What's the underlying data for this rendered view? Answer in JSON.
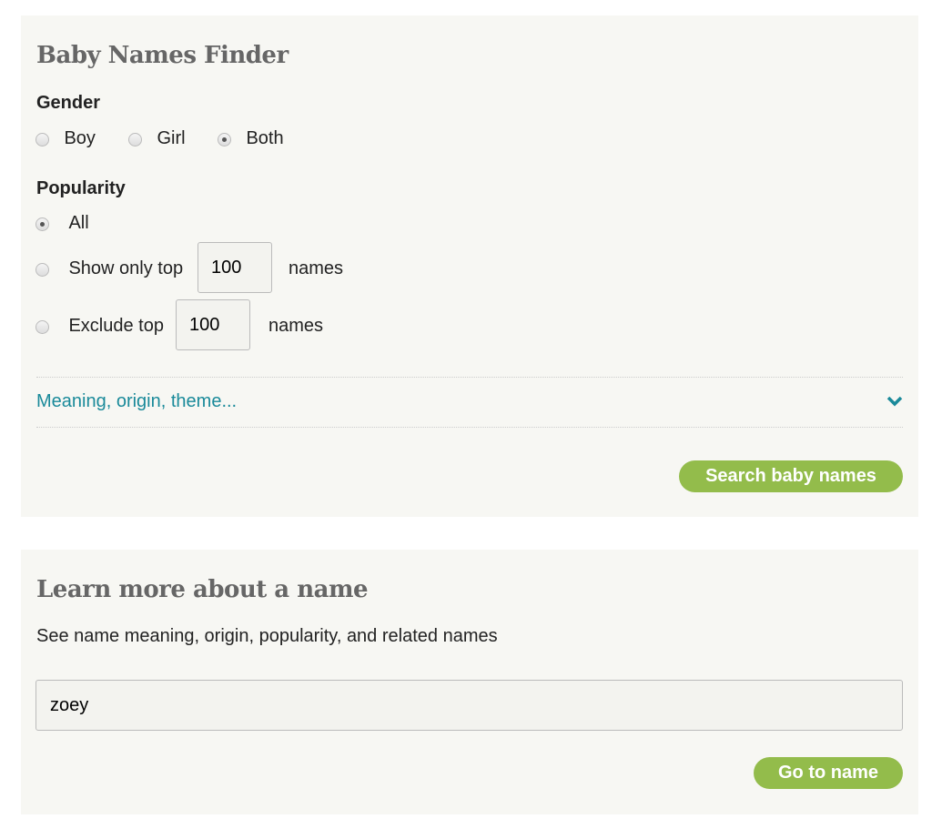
{
  "finder": {
    "title": "Baby Names Finder",
    "gender_label": "Gender",
    "gender_options": [
      "Boy",
      "Girl",
      "Both"
    ],
    "gender_selected": "Both",
    "popularity_label": "Popularity",
    "pop_all": "All",
    "pop_top": "Show only top",
    "pop_top_value": "100",
    "pop_top_suffix": "names",
    "pop_exclude": "Exclude top",
    "pop_exclude_value": "100",
    "pop_exclude_suffix": "names",
    "pop_selected": "All",
    "more_link": "Meaning, origin, theme...",
    "search_button": "Search baby names"
  },
  "learn": {
    "title": "Learn more about a name",
    "subtitle": "See name meaning, origin, popularity, and related names",
    "input_value": "zoey",
    "go_button": "Go to name"
  },
  "colors": {
    "accent_green": "#93bc4b",
    "link_teal": "#1a8a9a",
    "panel_bg": "#f7f7f3"
  }
}
